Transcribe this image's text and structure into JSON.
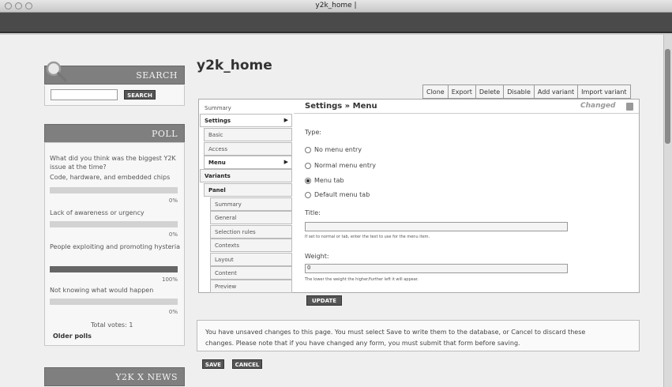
{
  "window": {
    "title": "y2k_home |"
  },
  "search": {
    "heading": "SEARCH",
    "button": "SEARCH",
    "input_value": ""
  },
  "poll": {
    "heading": "POLL",
    "question": "What did you think was the biggest Y2K issue at the time?",
    "options": [
      {
        "label": "Code, hardware, and embedded chips",
        "pct_text": "0%",
        "fraction": 0
      },
      {
        "label": "Lack of awareness or urgency",
        "pct_text": "0%",
        "fraction": 0
      },
      {
        "label": "People exploiting and promoting hysteria",
        "pct_text": "100%",
        "fraction": 1
      },
      {
        "label": "Not knowing what would happen",
        "pct_text": "0%",
        "fraction": 0
      }
    ],
    "total_votes": "Total votes: 1",
    "older_polls": "Older polls"
  },
  "news": {
    "heading": "Y2K X NEWS"
  },
  "main": {
    "page_title": "y2k_home",
    "tabs": [
      "Clone",
      "Export",
      "Delete",
      "Disable",
      "Add variant",
      "Import variant"
    ],
    "nav": {
      "summary": "Summary",
      "settings": "Settings",
      "basic": "Basic",
      "access": "Access",
      "menu": "Menu",
      "variants": "Variants",
      "panel": "Panel",
      "panel_summary": "Summary",
      "general": "General",
      "selection_rules": "Selection rules",
      "contexts": "Contexts",
      "layout": "Layout",
      "content": "Content",
      "preview": "Preview"
    },
    "settings_title": "Settings » Menu",
    "changed": "Changed",
    "type_label": "Type:",
    "radio_options": [
      "No menu entry",
      "Normal menu entry",
      "Menu tab",
      "Default menu tab"
    ],
    "selected_radio": "Menu tab",
    "title_label": "Title:",
    "title_value": "",
    "title_help": "If set to normal or tab, enter the text to use for the menu item.",
    "weight_label": "Weight:",
    "weight_value": "0",
    "weight_help": "The lower the weight the higher/further left it will appear.",
    "update_button": "UPDATE",
    "message_line1": "You have unsaved changes to this page. You must select Save to write them to the database, or Cancel to discard these",
    "message_line2": "changes. Please note that if you have changed any form, you must submit that form before saving.",
    "save_button": "SAVE",
    "cancel_button": "CANCEL"
  }
}
